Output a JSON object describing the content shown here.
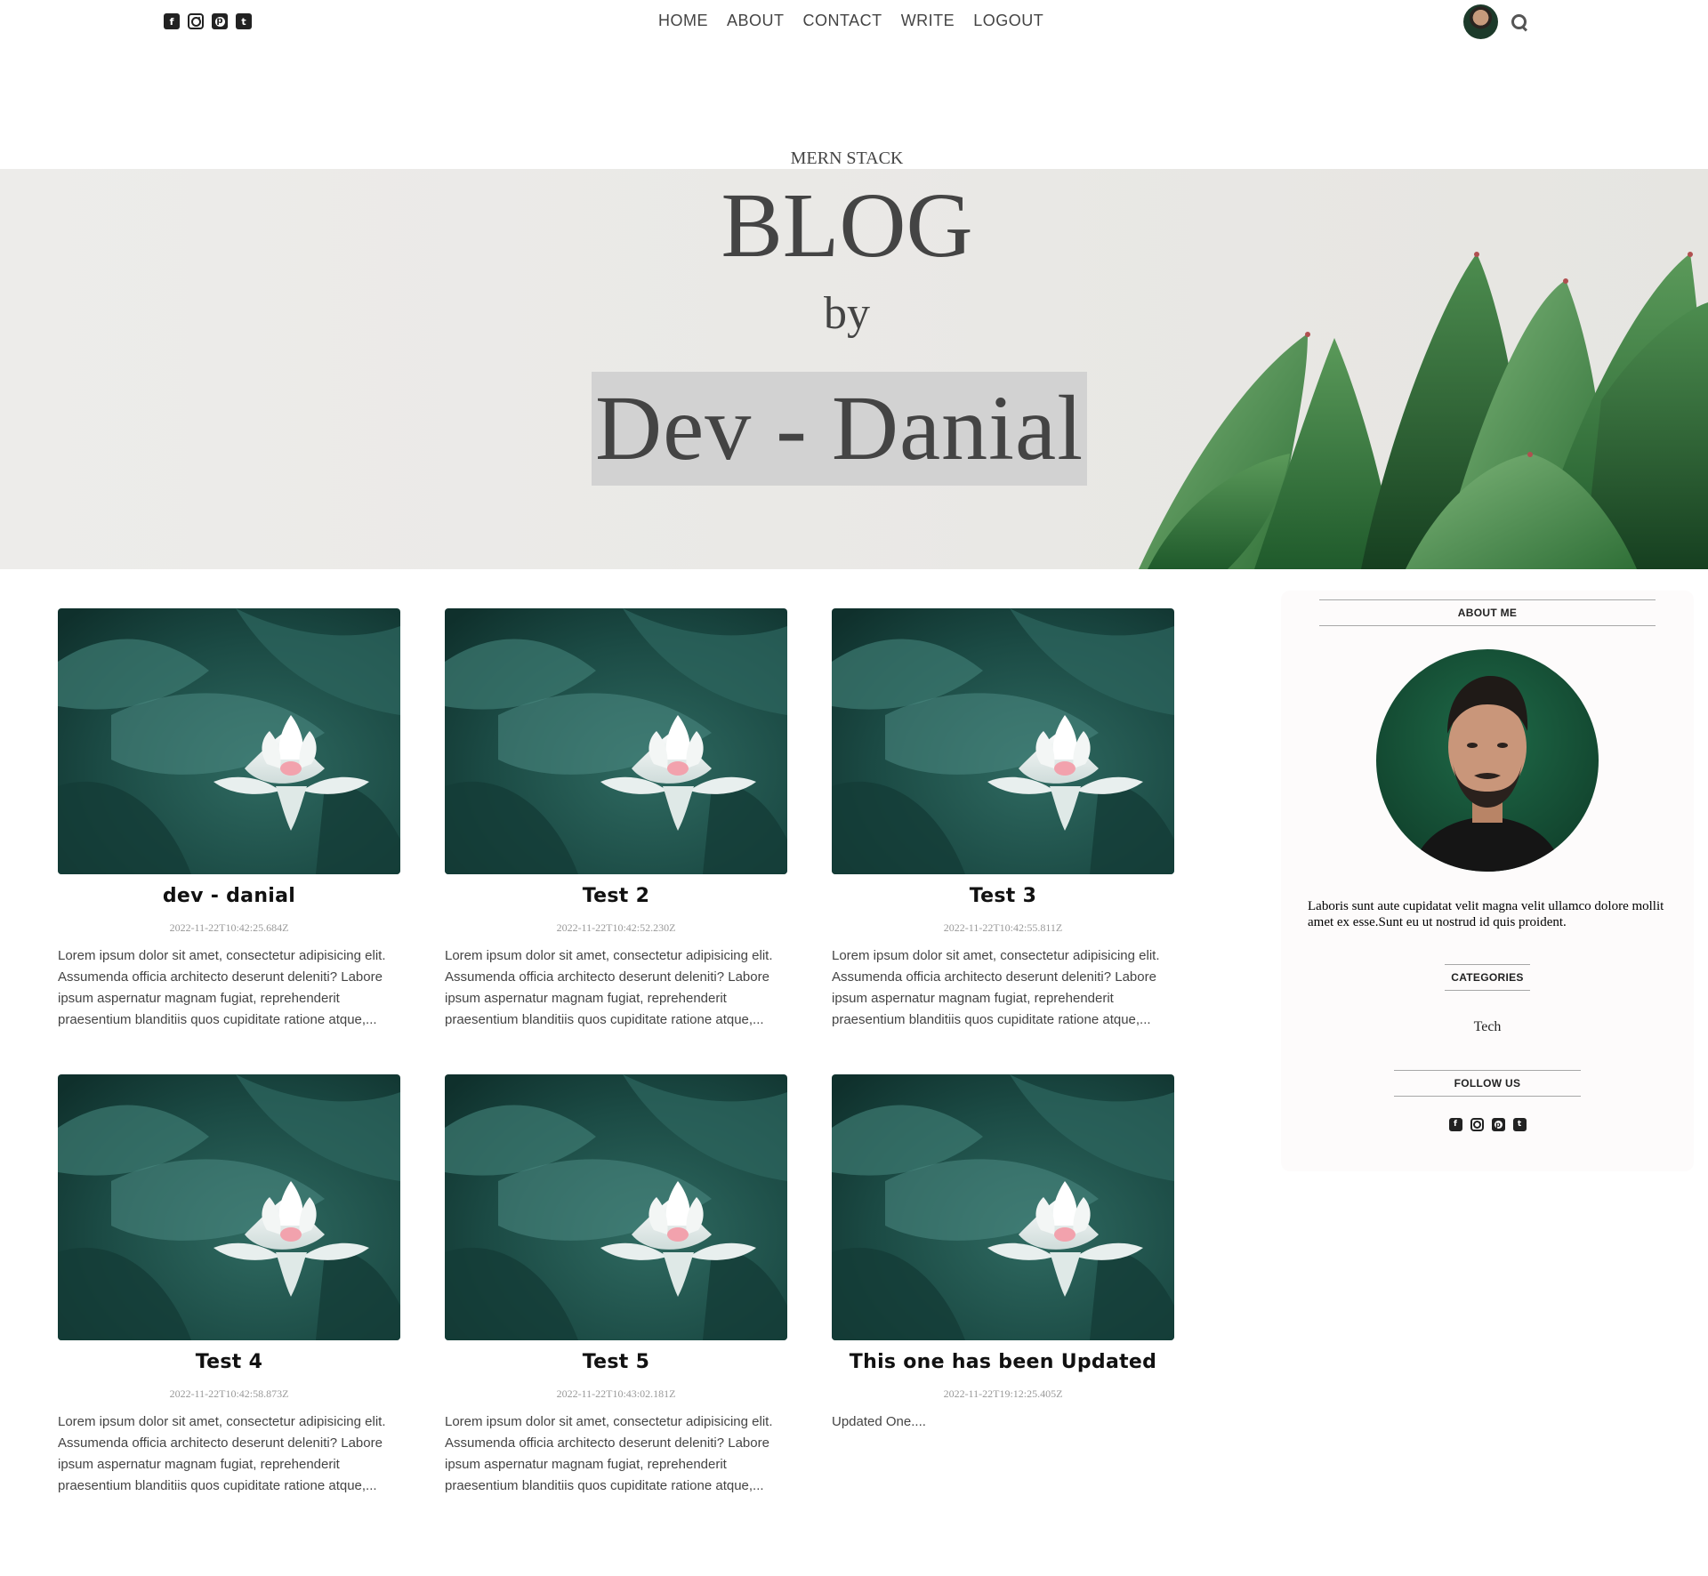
{
  "topbar": {
    "social_icons": [
      "facebook-square-icon",
      "instagram-square-icon",
      "pinterest-square-icon",
      "twitter-square-icon"
    ],
    "nav": [
      "HOME",
      "ABOUT",
      "CONTACT",
      "WRITE",
      "LOGOUT"
    ]
  },
  "header": {
    "subtitle": "MERN STACK",
    "title": "BLOG",
    "by": "by",
    "name": "Dev - Danial"
  },
  "posts": [
    {
      "title": "dev - danial",
      "date": "2022-11-22T10:42:25.684Z",
      "desc": "Lorem ipsum dolor sit amet, consectetur adipisicing elit. Assumenda officia architecto deserunt deleniti? Labore ipsum aspernatur magnam fugiat, reprehenderit praesentium blanditiis quos cupiditate ratione atque,..."
    },
    {
      "title": "Test 2",
      "date": "2022-11-22T10:42:52.230Z",
      "desc": "Lorem ipsum dolor sit amet, consectetur adipisicing elit. Assumenda officia architecto deserunt deleniti? Labore ipsum aspernatur magnam fugiat, reprehenderit praesentium blanditiis quos cupiditate ratione atque,..."
    },
    {
      "title": "Test 3",
      "date": "2022-11-22T10:42:55.811Z",
      "desc": "Lorem ipsum dolor sit amet, consectetur adipisicing elit. Assumenda officia architecto deserunt deleniti? Labore ipsum aspernatur magnam fugiat, reprehenderit praesentium blanditiis quos cupiditate ratione atque,..."
    },
    {
      "title": "Test 4",
      "date": "2022-11-22T10:42:58.873Z",
      "desc": "Lorem ipsum dolor sit amet, consectetur adipisicing elit. Assumenda officia architecto deserunt deleniti? Labore ipsum aspernatur magnam fugiat, reprehenderit praesentium blanditiis quos cupiditate ratione atque,..."
    },
    {
      "title": "Test 5",
      "date": "2022-11-22T10:43:02.181Z",
      "desc": "Lorem ipsum dolor sit amet, consectetur adipisicing elit. Assumenda officia architecto deserunt deleniti? Labore ipsum aspernatur magnam fugiat, reprehenderit praesentium blanditiis quos cupiditate ratione atque,..."
    },
    {
      "title": "This one has been Updated",
      "date": "2022-11-22T19:12:25.405Z",
      "desc": "Updated One...."
    }
  ],
  "sidebar": {
    "about_heading": "ABOUT ME",
    "about_text": "Laboris sunt aute cupidatat velit magna velit ullamco dolore mollit amet ex esse.Sunt eu ut nostrud id quis proident.",
    "categories_heading": "CATEGORIES",
    "categories": [
      "Tech"
    ],
    "follow_heading": "FOLLOW US"
  },
  "colors": {
    "text": "#444444",
    "post_title": "#111111",
    "hero_bg": "#e9e8e5",
    "name_highlight": "#d2d2d2",
    "sidebar_bg": "#fdfbfb"
  }
}
